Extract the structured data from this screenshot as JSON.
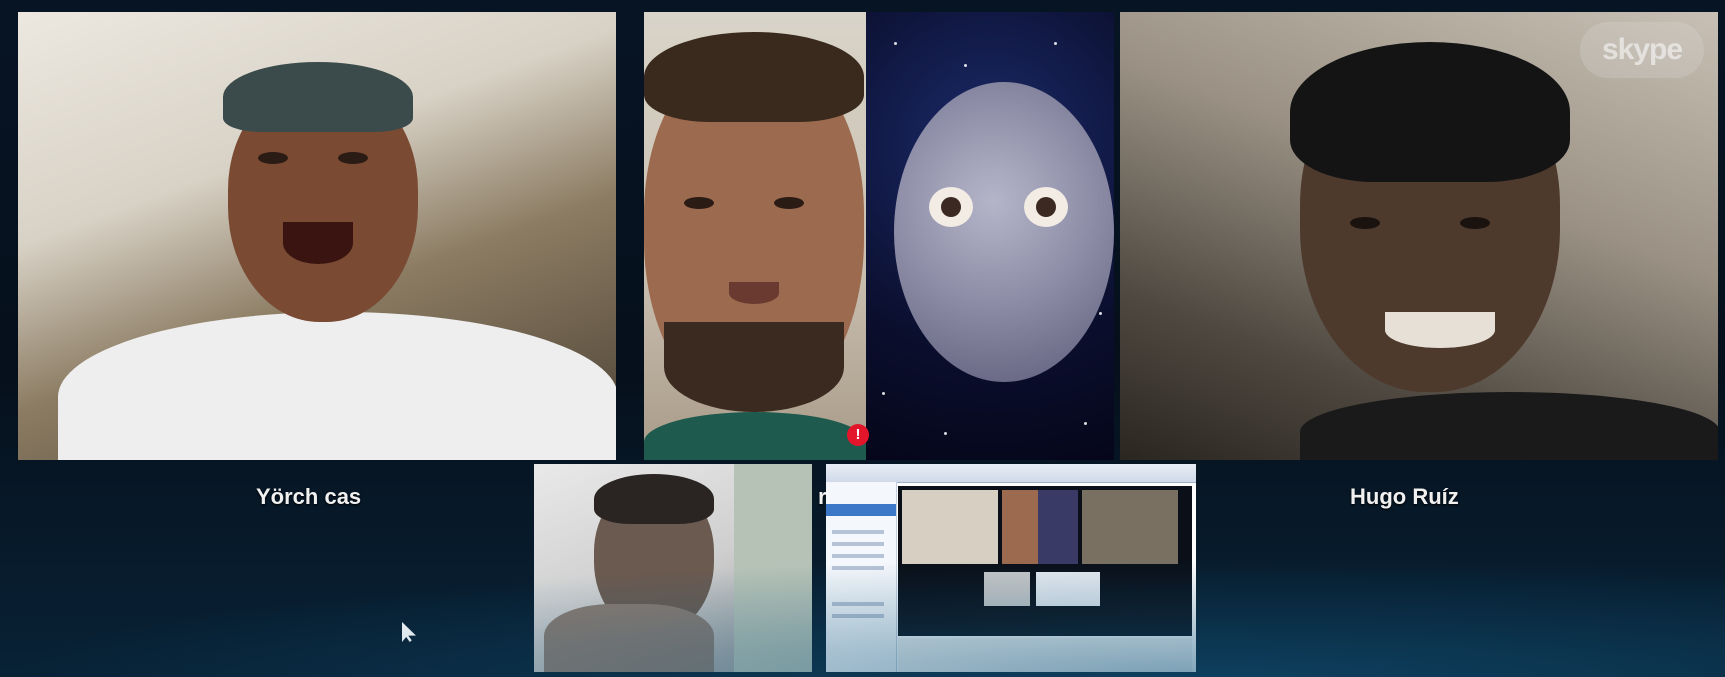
{
  "app": {
    "logo_text": "skype"
  },
  "participants": [
    {
      "name": "Yörch cas"
    },
    {
      "name_fragment": "r"
    },
    {
      "name": "Hugo Ruíz"
    }
  ],
  "badges": {
    "alert": "!"
  },
  "colors": {
    "background_dark": "#06101c",
    "background_glow": "#125880",
    "alert_badge": "#e3152b",
    "label_text": "#f0f0f0"
  },
  "icons": {
    "alert": "exclamation-badge-icon",
    "cursor": "mouse-pointer-icon",
    "logo": "skype-logo"
  }
}
